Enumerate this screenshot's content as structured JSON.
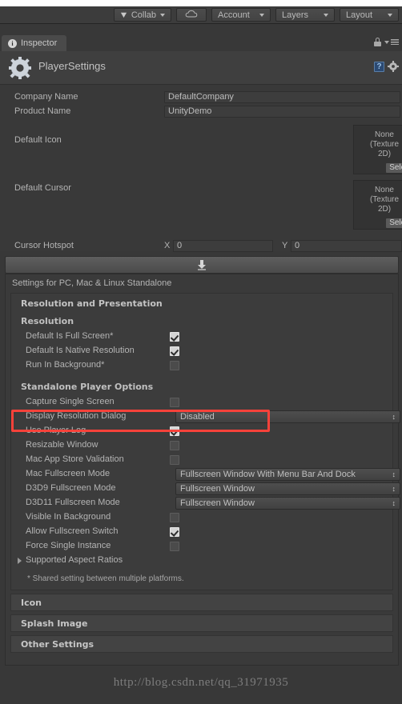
{
  "toolbar": {
    "collab_label": "Collab",
    "collab_icon": "gem-icon",
    "cloud_icon": "cloud-icon",
    "account_label": "Account",
    "layers_label": "Layers",
    "layout_label": "Layout"
  },
  "tab": {
    "label": "Inspector",
    "icon": "info-icon",
    "lock_icon": "lock-icon",
    "menu_icon": "hamburger-menu-icon"
  },
  "object_header": {
    "title": "PlayerSettings",
    "icon": "gear-icon",
    "help_label": "?",
    "settings_icon": "gear-icon"
  },
  "properties": {
    "company_name": {
      "label": "Company Name",
      "value": "DefaultCompany"
    },
    "product_name": {
      "label": "Product Name",
      "value": "UnityDemo"
    },
    "default_icon": {
      "label": "Default Icon",
      "value": "None\n(Texture\n2D)",
      "value_line1": "None",
      "value_line2": "(Texture",
      "value_line3": "2D)",
      "select_label": "Select"
    },
    "default_cursor": {
      "label": "Default Cursor",
      "value_line1": "None",
      "value_line2": "(Texture",
      "value_line3": "2D)",
      "select_label": "Select"
    },
    "cursor_hotspot": {
      "label": "Cursor Hotspot",
      "x_label": "X",
      "x_value": "0",
      "y_label": "Y",
      "y_value": "0"
    }
  },
  "platform_bar": {
    "icon": "download-arrow-icon"
  },
  "settings": {
    "title": "Settings for PC, Mac & Linux Standalone",
    "group_header": "Resolution and Presentation",
    "resolution_header": "Resolution",
    "resolution_rows": [
      {
        "label": "Default Is Full Screen*",
        "checked": true
      },
      {
        "label": "Default Is Native Resolution",
        "checked": true
      },
      {
        "label": "Run In Background*",
        "checked": false
      }
    ],
    "standalone_header": "Standalone Player Options",
    "standalone_rows": [
      {
        "label": "Capture Single Screen",
        "type": "checkbox",
        "checked": false
      },
      {
        "label": "Display Resolution Dialog",
        "type": "dropdown",
        "value": "Disabled",
        "highlighted": true
      },
      {
        "label": "Use Player Log",
        "type": "checkbox",
        "checked": true
      },
      {
        "label": "Resizable Window",
        "type": "checkbox",
        "checked": false
      },
      {
        "label": "Mac App Store Validation",
        "type": "checkbox",
        "checked": false
      },
      {
        "label": "Mac Fullscreen Mode",
        "type": "dropdown",
        "value": "Fullscreen Window With Menu Bar And Dock"
      },
      {
        "label": "D3D9 Fullscreen Mode",
        "type": "dropdown",
        "value": "Fullscreen Window"
      },
      {
        "label": "D3D11 Fullscreen Mode",
        "type": "dropdown",
        "value": "Fullscreen Window"
      },
      {
        "label": "Visible In Background",
        "type": "checkbox",
        "checked": false
      },
      {
        "label": "Allow Fullscreen Switch",
        "type": "checkbox",
        "checked": true
      },
      {
        "label": "Force Single Instance",
        "type": "checkbox",
        "checked": false
      }
    ],
    "aspect_ratios_label": "Supported Aspect Ratios",
    "footnote": "* Shared setting between multiple platforms.",
    "collapsed_sections": [
      "Icon",
      "Splash Image",
      "Other Settings"
    ]
  },
  "highlight": {
    "color": "#f9423a"
  },
  "watermark": {
    "text": "http://blog.csdn.net/qq_31971935"
  }
}
